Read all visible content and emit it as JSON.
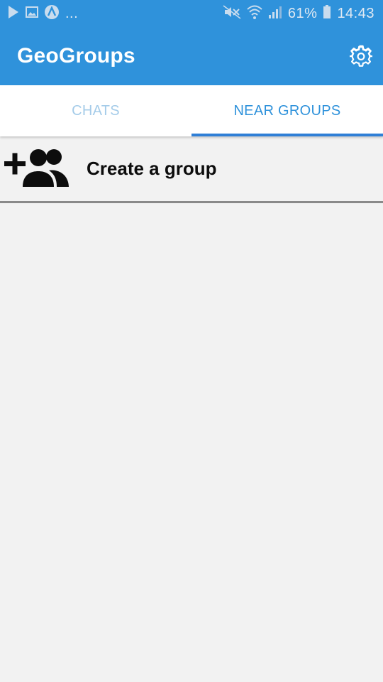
{
  "status_bar": {
    "notifications_more": "...",
    "battery_percent": "61%",
    "time": "14:43",
    "icons": [
      "play-store-icon",
      "image-icon",
      "a-circle-icon",
      "muted-icon",
      "wifi-icon",
      "signal-icon",
      "battery-icon"
    ]
  },
  "app_bar": {
    "title": "GeoGroups",
    "settings_icon": "gear-icon"
  },
  "tabs": [
    {
      "label": "CHATS",
      "active": false
    },
    {
      "label": "NEAR GROUPS",
      "active": true
    }
  ],
  "create_group": {
    "label": "Create a group",
    "icon": "group-add-icon"
  },
  "colors": {
    "primary": "#2f92db",
    "tab_active": "#2f92db",
    "tab_inactive": "#a5cce9",
    "background": "#f2f2f2"
  }
}
